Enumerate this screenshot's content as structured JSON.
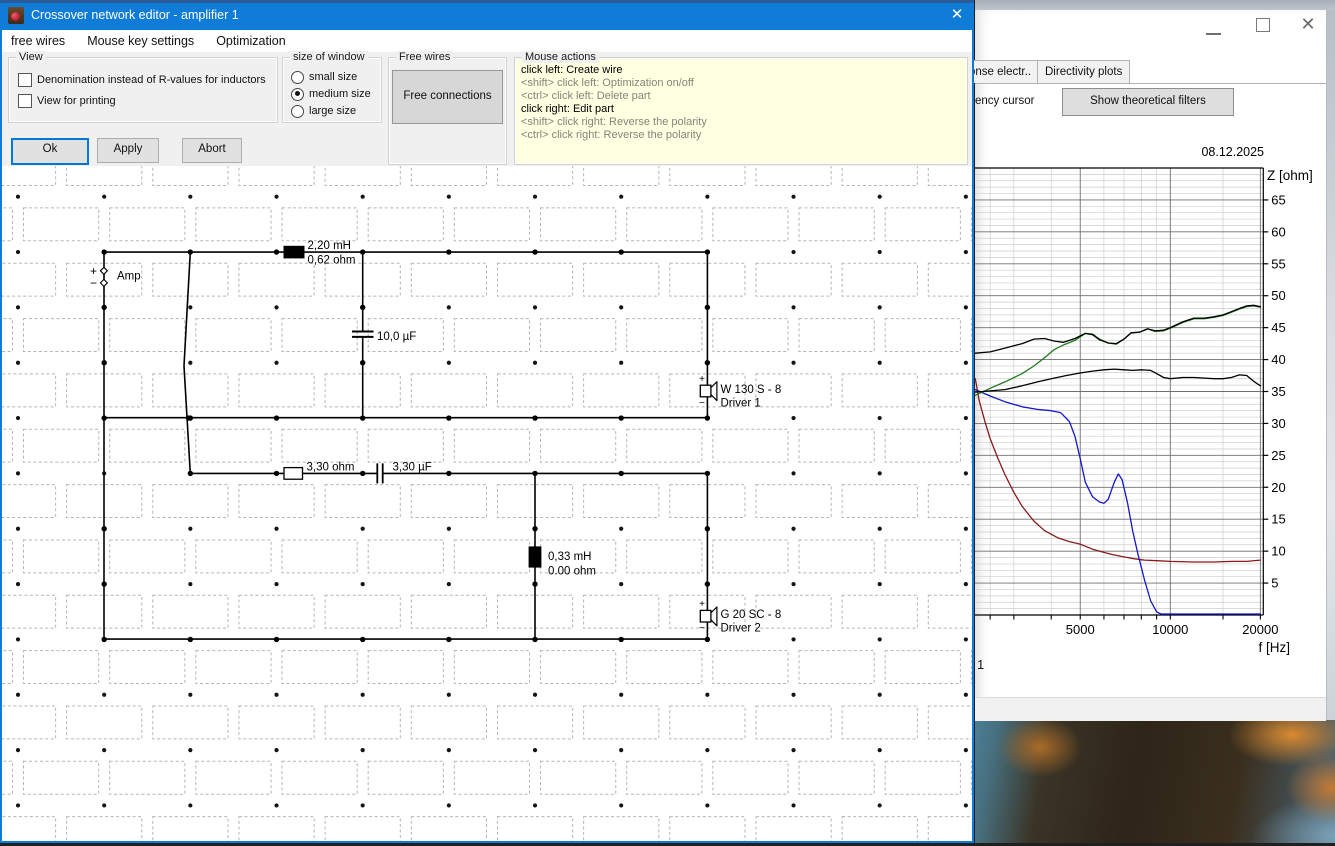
{
  "editor_window": {
    "title": "Crossover network editor - amplifier 1",
    "menu": [
      "free wires",
      "Mouse key settings",
      "Optimization"
    ],
    "view_group": {
      "label": "View",
      "checkboxes": [
        {
          "label": "Denomination instead of R-values for inductors",
          "checked": false
        },
        {
          "label": "View for printing",
          "checked": false
        }
      ]
    },
    "size_group": {
      "label": "size of window",
      "options": [
        {
          "label": "small size",
          "selected": false
        },
        {
          "label": "medium size",
          "selected": true
        },
        {
          "label": "large size",
          "selected": false
        }
      ]
    },
    "free_wires_group": {
      "label": "Free wires",
      "button": "Free connections"
    },
    "mouse_actions_group": {
      "label": "Mouse actions",
      "lines": [
        {
          "text": "click left: Create wire",
          "muted": false
        },
        {
          "text": "<shift> click left: Optimization on/off",
          "muted": true
        },
        {
          "text": "<ctrl> click left: Delete part",
          "muted": true
        },
        {
          "text": "click right: Edit part",
          "muted": false
        },
        {
          "text": "<shift> click right: Reverse the polarity",
          "muted": true
        },
        {
          "text": "<ctrl> click right: Reverse the polarity",
          "muted": true
        }
      ]
    },
    "buttons": {
      "ok": "Ok",
      "apply": "Apply",
      "abort": "Abort"
    },
    "circuit": {
      "amp_plus": "+",
      "amp_minus": "−",
      "amp_label": "Amp",
      "l1_value": "2,20 mH",
      "l1_res": "0,62 ohm",
      "c1_label": "10,0 µF",
      "r1_label": "3,30 ohm",
      "c2_label": "3,30 µF",
      "l2_value": "0,33 mH",
      "l2_res": "0.00 ohm",
      "d1_plus": "+",
      "d1_minus": "−",
      "d1_name": "W 130 S - 8",
      "d1_label": "Driver 1",
      "d2_plus": "+",
      "d2_minus": "−",
      "d2_name": "G 20 SC - 8",
      "d2_label": "Driver 2"
    }
  },
  "plot_window": {
    "tabs": [
      "onse electr..",
      "Directivity plots"
    ],
    "toolbar_text": "ency cursor",
    "filter_button": "Show theoretical filters",
    "date": "08.12.2025",
    "corner_text": "1"
  },
  "icons": {
    "close_editor": "✕",
    "close_plot": "✕"
  },
  "chart_data": {
    "type": "line",
    "title": "08.12.2025",
    "xlabel": "f [Hz]",
    "ylabel": "Z [ohm]",
    "x_scale": "log",
    "xlim": [
      2230,
      20000
    ],
    "ylim": [
      0,
      70
    ],
    "x_ticks": [
      5000,
      10000,
      20000
    ],
    "x_minor": [
      2500,
      3000,
      4000,
      6000,
      7000,
      8000,
      9000,
      15000
    ],
    "y_ticks": [
      5,
      10,
      15,
      20,
      25,
      30,
      35,
      40,
      45,
      50,
      55,
      60,
      65
    ],
    "y_minor_step": 1,
    "grid": true,
    "legend": "none",
    "series": [
      {
        "name": "driver2-impedance",
        "color": "#8a1a1a",
        "points": [
          [
            2230,
            37
          ],
          [
            2300,
            33.5
          ],
          [
            2400,
            30.3
          ],
          [
            2500,
            27.6
          ],
          [
            2650,
            24.6
          ],
          [
            2800,
            22
          ],
          [
            3000,
            19.2
          ],
          [
            3200,
            17
          ],
          [
            3500,
            14.7
          ],
          [
            3800,
            13.2
          ],
          [
            4200,
            12.1
          ],
          [
            4600,
            11.5
          ],
          [
            5000,
            11.1
          ],
          [
            5500,
            10.3
          ],
          [
            6000,
            9.8
          ],
          [
            6500,
            9.4
          ],
          [
            7000,
            9.1
          ],
          [
            7600,
            8.8
          ],
          [
            8200,
            8.6
          ],
          [
            9000,
            8.5
          ],
          [
            10000,
            8.4
          ],
          [
            12000,
            8.3
          ],
          [
            14000,
            8.3
          ],
          [
            16000,
            8.4
          ],
          [
            18000,
            8.4
          ],
          [
            20000,
            8.6
          ]
        ]
      },
      {
        "name": "driver1-impedance",
        "color": "#1515cc",
        "points": [
          [
            2230,
            35.3
          ],
          [
            2500,
            34.3
          ],
          [
            2800,
            33.4
          ],
          [
            3200,
            32.6
          ],
          [
            3600,
            32.2
          ],
          [
            4000,
            32
          ],
          [
            4300,
            31.7
          ],
          [
            4600,
            30.3
          ],
          [
            4800,
            28
          ],
          [
            5000,
            24.5
          ],
          [
            5200,
            20.8
          ],
          [
            5500,
            18.5
          ],
          [
            5800,
            17.7
          ],
          [
            6000,
            17.5
          ],
          [
            6200,
            18.1
          ],
          [
            6500,
            20.8
          ],
          [
            6700,
            22.1
          ],
          [
            6900,
            21.2
          ],
          [
            7200,
            17.5
          ],
          [
            7500,
            13
          ],
          [
            7800,
            9.5
          ],
          [
            8200,
            5.5
          ],
          [
            8600,
            2.2
          ],
          [
            9000,
            0.5
          ],
          [
            9300,
            0.15
          ],
          [
            10000,
            0.15
          ],
          [
            20000,
            0.15
          ]
        ]
      },
      {
        "name": "filtered-green",
        "color": "#1f7a1f",
        "points": [
          [
            2230,
            34.4
          ],
          [
            2500,
            35.5
          ],
          [
            2800,
            36.5
          ],
          [
            3200,
            37.8
          ],
          [
            3500,
            39
          ],
          [
            3800,
            40.3
          ],
          [
            4100,
            41.6
          ],
          [
            4400,
            42.3
          ],
          [
            4800,
            43
          ],
          [
            5200,
            44.1
          ],
          [
            5500,
            44
          ],
          [
            5800,
            43.2
          ],
          [
            6200,
            42.6
          ],
          [
            6600,
            42.4
          ],
          [
            7000,
            43.2
          ],
          [
            7400,
            44.2
          ],
          [
            7900,
            44.3
          ],
          [
            8400,
            44.8
          ],
          [
            8900,
            44.4
          ],
          [
            9500,
            44.5
          ],
          [
            10000,
            44.9
          ],
          [
            11000,
            45.8
          ],
          [
            12000,
            46.4
          ],
          [
            13000,
            46.4
          ],
          [
            14000,
            46.6
          ],
          [
            15000,
            46.9
          ],
          [
            16000,
            47.4
          ],
          [
            17000,
            47.9
          ],
          [
            18000,
            48.3
          ],
          [
            19000,
            48.4
          ],
          [
            20000,
            48.2
          ]
        ]
      },
      {
        "name": "total-impedance-mid",
        "color": "#000000",
        "points": [
          [
            2230,
            34.9
          ],
          [
            2500,
            35.1
          ],
          [
            2800,
            35.3
          ],
          [
            3200,
            35.9
          ],
          [
            3600,
            36.5
          ],
          [
            4000,
            37
          ],
          [
            4500,
            37.5
          ],
          [
            5000,
            37.9
          ],
          [
            5500,
            38.2
          ],
          [
            6000,
            38.4
          ],
          [
            6500,
            38.5
          ],
          [
            7000,
            38.4
          ],
          [
            7500,
            38.3
          ],
          [
            8000,
            38.4
          ],
          [
            8600,
            38.3
          ],
          [
            9000,
            37.8
          ],
          [
            9500,
            37.2
          ],
          [
            10000,
            37
          ],
          [
            11000,
            37.2
          ],
          [
            12000,
            37.2
          ],
          [
            13000,
            37.1
          ],
          [
            14000,
            37
          ],
          [
            15000,
            37
          ],
          [
            16000,
            37.2
          ],
          [
            17000,
            37.6
          ],
          [
            18000,
            37.5
          ],
          [
            19000,
            36.6
          ],
          [
            20000,
            35.9
          ]
        ]
      },
      {
        "name": "total-impedance-upper",
        "color": "#000000",
        "points": [
          [
            2230,
            41
          ],
          [
            2500,
            41.2
          ],
          [
            2800,
            41.8
          ],
          [
            3200,
            42.5
          ],
          [
            3500,
            43.2
          ],
          [
            3800,
            43.3
          ],
          [
            4100,
            42.9
          ],
          [
            4400,
            42.7
          ],
          [
            4800,
            43.3
          ],
          [
            5200,
            44.1
          ],
          [
            5500,
            43.9
          ],
          [
            5800,
            43.1
          ],
          [
            6200,
            42.6
          ],
          [
            6600,
            42.5
          ],
          [
            7000,
            43.2
          ],
          [
            7400,
            44.2
          ],
          [
            7900,
            44.3
          ],
          [
            8400,
            44.8
          ],
          [
            8900,
            44.5
          ],
          [
            9500,
            44.6
          ],
          [
            10000,
            45
          ],
          [
            11000,
            45.9
          ],
          [
            12000,
            46.5
          ],
          [
            13000,
            46.5
          ],
          [
            14000,
            46.7
          ],
          [
            15000,
            47
          ],
          [
            16000,
            47.5
          ],
          [
            17000,
            48
          ],
          [
            18000,
            48.4
          ],
          [
            19000,
            48.5
          ],
          [
            20000,
            48.3
          ]
        ]
      }
    ]
  }
}
